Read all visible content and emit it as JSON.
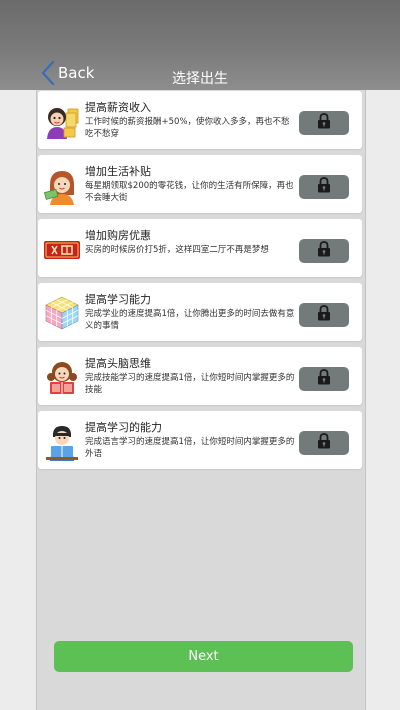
{
  "header": {
    "back_label": "Back",
    "title": "选择出生",
    "back_icon": "chevron-left-icon"
  },
  "cards": [
    {
      "title": "提高薪资收入",
      "desc": "工作时候的薪资报酬+50%，使你收入多多，再也不愁吃不愁穿",
      "icon": "salary-avatar-icon",
      "locked": true
    },
    {
      "title": "增加生活补贴",
      "desc": "每星期领取$200的零花钱，让你的生活有所保障，再也不会睡大街",
      "icon": "allowance-avatar-icon",
      "locked": true
    },
    {
      "title": "增加购房优惠",
      "desc": "买房的时候房价打5折，这样四室二厅不再是梦想",
      "icon": "discount-tag-icon",
      "locked": true
    },
    {
      "title": "提高学习能力",
      "desc": "完成学业的速度提高1倍，让你腾出更多的时间去做有意义的事情",
      "icon": "rubiks-cube-icon",
      "locked": true
    },
    {
      "title": "提高头脑思维",
      "desc": "完成技能学习的速度提高1倍，让你短时间内掌握更多的技能",
      "icon": "girl-reading-icon",
      "locked": true
    },
    {
      "title": "提高学习的能力",
      "desc": "完成语言学习的速度提高1倍，让你短时间内掌握更多的外语",
      "icon": "boy-reading-icon",
      "locked": true
    }
  ],
  "footer": {
    "next_label": "Next"
  },
  "colors": {
    "header_bg": "#7a7a7a",
    "panel_bg": "#d9d9d9",
    "lock_bg": "#727b7a",
    "next_bg": "#5cc055",
    "back_chevron": "#3a6fb5"
  }
}
